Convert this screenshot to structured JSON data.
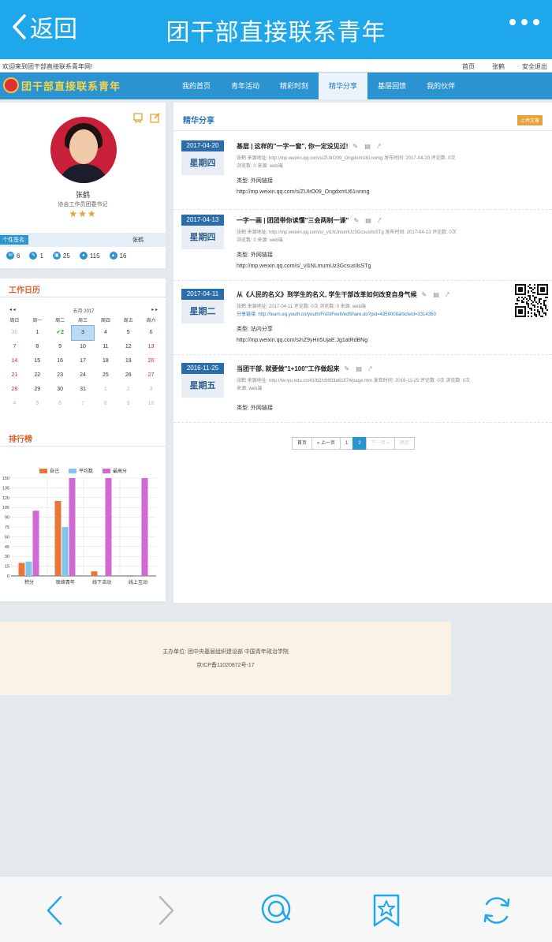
{
  "appbar": {
    "back_label": "返回",
    "title": "团干部直接联系青年"
  },
  "topstrip": {
    "welcome": "欢迎来到团干部直接联系青年网!",
    "links": [
      "首页",
      "张鹤",
      "安全退出"
    ]
  },
  "site": {
    "logo_text": "团干部直接联系青年"
  },
  "nav": {
    "items": [
      "我的首页",
      "青年活动",
      "精彩时刻",
      "精华分享",
      "基层回馈",
      "我的伙伴"
    ],
    "active_index": 3
  },
  "profile": {
    "name": "张鹤",
    "title": "协会工作员团委书记",
    "stars": "★★★",
    "member_tag": "个性签名:",
    "member_name": "张鹤",
    "stats": [
      "6",
      "1",
      "25",
      "115",
      "16"
    ]
  },
  "calendar": {
    "heading": "工作日历",
    "prev": "◂ ◂",
    "month": "五月 2017",
    "next": "▸ ▸",
    "weekdays": [
      "周日",
      "周一",
      "周二",
      "周三",
      "周四",
      "周五",
      "周六"
    ],
    "days": [
      [
        "30",
        "1",
        "2",
        "3",
        "4",
        "5",
        "6"
      ],
      [
        "7",
        "8",
        "9",
        "10",
        "11",
        "12",
        "13"
      ],
      [
        "14",
        "15",
        "16",
        "17",
        "18",
        "19",
        "20"
      ],
      [
        "21",
        "22",
        "23",
        "24",
        "25",
        "26",
        "27"
      ],
      [
        "28",
        "29",
        "30",
        "31",
        "1",
        "2",
        "3"
      ],
      [
        "4",
        "5",
        "6",
        "7",
        "8",
        "9",
        "10"
      ]
    ]
  },
  "ranking": {
    "heading": "排行榜"
  },
  "chart_data": {
    "type": "bar",
    "categories": [
      "积分",
      "联络青年",
      "线下活动",
      "线上互动"
    ],
    "series": [
      {
        "name": "自己",
        "values": [
          20,
          115,
          7,
          0
        ],
        "color": "#e8773a"
      },
      {
        "name": "平均数",
        "values": [
          22,
          75,
          1,
          1
        ],
        "color": "#7fc6ee"
      },
      {
        "name": "最高分",
        "values": [
          100,
          150,
          150,
          150
        ],
        "color": "#d06ad2"
      }
    ],
    "ylim": [
      0,
      150
    ],
    "yticks": [
      "0",
      "15",
      "30",
      "45",
      "60",
      "75",
      "90",
      "105",
      "120",
      "135",
      "150"
    ],
    "legend": "top"
  },
  "main": {
    "heading": "精华分享",
    "upload_label": "上传文章",
    "posts": [
      {
        "date": "2017-04-20",
        "weekday": "星期四",
        "title": "基层 | 这样的\"一字一窗\", 你一定没见过!",
        "icons": "✎ ▤ ⤤",
        "meta1": "张鹤  来源地址: http://mp.weixin.qq.com/s/ZUIrO09_OngdxmU61nnmg  发布时间: 2017-04-20  评论数: 0次",
        "meta2": "浏览数: 0  来源: web端",
        "type_label": "类型: 外网链接",
        "url": "http://mp.weixin.qq.com/s/ZUIrO09_OngdxmU61nnmg"
      },
      {
        "date": "2017-04-13",
        "weekday": "星期四",
        "title": "一字一画 | 团团带你读懂\"三会两制一课\"",
        "icons": "✎ ▤ ⤤",
        "meta1": "张鹤  来源地址: http://mp.weixin.qq.com/s/_vl1NJmumUz3GcsusIlsSTg  发布时间: 2017-04-13  评论数: 0次",
        "meta2": "浏览数: 0  来源: web端",
        "type_label": "类型: 外网链接",
        "url": "http://mp.weixin.qq.com/s/_vl1NLmumUz3GcsusIlsSTg"
      },
      {
        "date": "2017-04-11",
        "weekday": "星期二",
        "title": "从《人民的名义》到学生的名义, 学生干部改革如何改变自身气候",
        "icons": "✎ ▤ ⤤",
        "meta1": "张鹤  来源地址: 2017-04-11  评论数: 0次  浏览数: 0  来源: web端",
        "meta2": "分享链接: http://learn.eq.youth.cn/youth/FrontFeelVedShare.do?pid=4359008articleId=3314350",
        "type_label": "类型: 站内分享",
        "url": "http://mp.weixin.qq.com/s/nZ9yHn5UjaE.Jg1atRdBNg"
      },
      {
        "date": "2016-11-25",
        "weekday": "星期五",
        "title": "当团干部, 就要做\"1+100\"工作做起来",
        "icons": "✎ ▤ ⤤",
        "meta1": "张鹤  来源地址: http://tw.lyu.edu.cn/41/b2/c6693a61874/page.htm  发布时间: 2016-11-25  评论数: 0次  浏览数: 0次",
        "meta2": "来源: web端",
        "type_label": "类型: 外网链接",
        "url": ""
      }
    ],
    "pager": [
      "首页",
      "« 上一页",
      "1",
      "2",
      "下一页 »",
      "尾页"
    ],
    "pager_current": 3
  },
  "footer": {
    "line1": "主办单位: 团中央基层组织建设部 中国青年政治学院",
    "line2": "京ICP备11020872号-17"
  },
  "bottombar": [
    "back-arrow-icon",
    "forward-arrow-icon",
    "comment-icon",
    "bookmark-star-icon",
    "refresh-icon"
  ]
}
